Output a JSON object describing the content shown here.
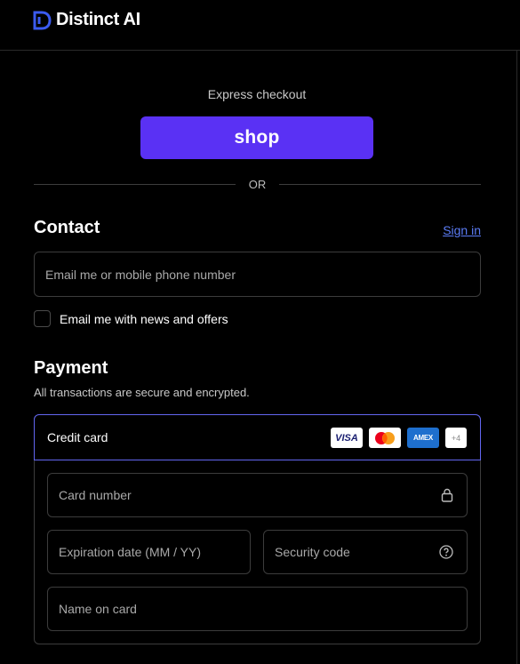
{
  "brand": {
    "name": "Distinct AI"
  },
  "express": {
    "label": "Express checkout",
    "shop_button": "shop",
    "divider": "OR"
  },
  "contact": {
    "title": "Contact",
    "sign_in": "Sign in",
    "email_placeholder": "Email me or mobile phone number",
    "newsletter_label": "Email me with news and offers",
    "newsletter_checked": false
  },
  "payment": {
    "title": "Payment",
    "subtitle": "All transactions are secure and encrypted.",
    "method": "Credit card",
    "card_brands": [
      "VISA",
      "mastercard",
      "AMEX",
      "+4"
    ],
    "card_number_placeholder": "Card number",
    "expiry_placeholder": "Expiration date (MM / YY)",
    "security_placeholder": "Security code",
    "name_placeholder": "Name on card"
  },
  "colors": {
    "shop_purple": "#5a31f4",
    "link_blue": "#5b7cf5",
    "selected_border": "#6266f0"
  }
}
